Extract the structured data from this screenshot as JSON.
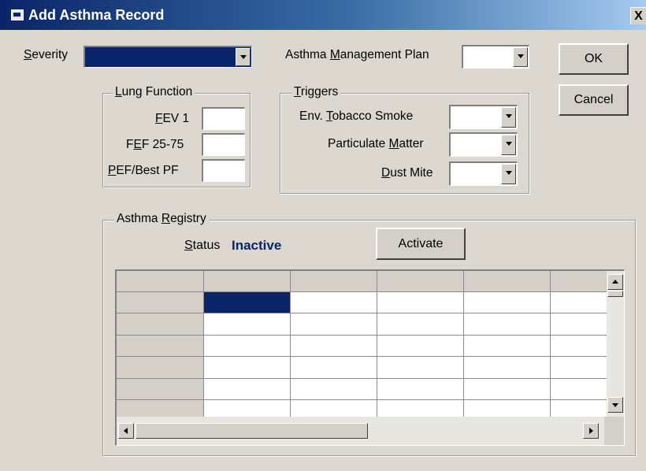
{
  "window": {
    "title": "Add Asthma Record",
    "close_glyph": "X"
  },
  "severity": {
    "label_u": "S",
    "label_rest": "everity",
    "value": ""
  },
  "management_plan": {
    "label_pre": "Asthma ",
    "label_u": "M",
    "label_rest": "anagement Plan",
    "value": ""
  },
  "buttons": {
    "ok": "OK",
    "cancel": "Cancel",
    "activate": "Activate"
  },
  "lung_function": {
    "legend_u": "L",
    "legend_rest": "ung Function",
    "fev1": {
      "label_u": "F",
      "label_rest": "EV 1",
      "value": ""
    },
    "fef": {
      "label_pre": "F",
      "label_u": "E",
      "label_rest": "F 25-75",
      "value": ""
    },
    "pef": {
      "label_u": "P",
      "label_rest": "EF/Best PF",
      "value": ""
    }
  },
  "triggers": {
    "legend_u": "T",
    "legend_rest": "riggers",
    "tobacco": {
      "label_pre": "Env. ",
      "label_u": "T",
      "label_rest": "obacco Smoke",
      "value": ""
    },
    "particulate": {
      "label_pre": "Particulate ",
      "label_u": "M",
      "label_rest": "atter",
      "value": ""
    },
    "dust": {
      "label_u": "D",
      "label_rest": "ust Mite",
      "value": ""
    }
  },
  "registry": {
    "legend_pre": "Asthma ",
    "legend_u": "R",
    "legend_rest": "egistry",
    "status_label_u": "S",
    "status_label_rest": "tatus",
    "status_value": "Inactive",
    "status_color": "#0a246a"
  },
  "grid": {
    "columns": 5,
    "rows": 6,
    "selected": {
      "row": 0,
      "col": 0
    }
  },
  "colors": {
    "title_bar": "#0a246a",
    "selection": "#0a246a",
    "dialog_bg": "#dcd8cf"
  }
}
